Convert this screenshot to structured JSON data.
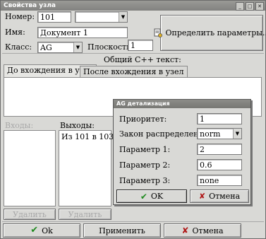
{
  "window": {
    "title": "Свойства узла",
    "controls": [
      "minimize-icon",
      "maximize-icon",
      "close-icon"
    ]
  },
  "form": {
    "number_label": "Номер:",
    "number_value": "101",
    "number_combo_value": "",
    "name_label": "Имя:",
    "name_value": "Документ 1",
    "class_label": "Класс:",
    "class_value": "AG",
    "plane_label": "Плоскость:",
    "plane_value": "1",
    "define_params_label": "Определить параметры..."
  },
  "cpp": {
    "header": "Общий С++ текст:",
    "tabs": [
      "До вхождения в узел",
      "После вхождения в узел"
    ],
    "active_tab": 0
  },
  "lists": {
    "inputs_label": "Входы:",
    "outputs_label": "Выходы:",
    "outputs_items": [
      "Из 101 в 103"
    ],
    "disabled_btn_1": "Удалить",
    "disabled_btn_2": "Удалить"
  },
  "footer": {
    "ok": "Ok",
    "apply": "Применить",
    "cancel": "Отмена"
  },
  "dialog": {
    "title": "AG детализация",
    "priority_label": "Приоритет:",
    "priority_value": "1",
    "dist_label": "Закон распределения:",
    "dist_value": "norm",
    "p1_label": "Параметр 1:",
    "p1_value": "2",
    "p2_label": "Параметр 2:",
    "p2_value": "0.6",
    "p3_label": "Параметр 3:",
    "p3_value": "none",
    "ok": "OK",
    "cancel": "Отмена"
  },
  "colors": {
    "ok_check": "#1f8a1f",
    "cancel_x": "#b01818"
  }
}
